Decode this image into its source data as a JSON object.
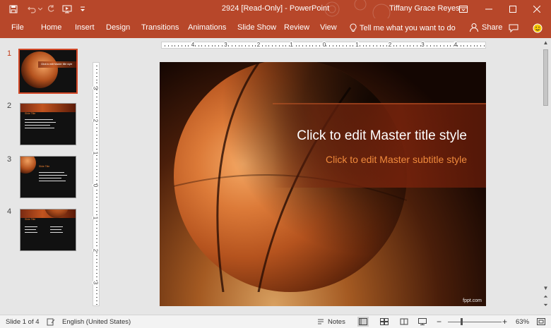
{
  "window": {
    "title": "2924 [Read-Only]  -  PowerPoint",
    "user": "Tiffany Grace Reyes"
  },
  "ribbon": {
    "tabs": [
      "File",
      "Home",
      "Insert",
      "Design",
      "Transitions",
      "Animations",
      "Slide Show",
      "Review",
      "View"
    ],
    "tell_me": "Tell me what you want to do",
    "share": "Share"
  },
  "thumbnails": [
    {
      "number": "1",
      "selected": true
    },
    {
      "number": "2",
      "selected": false
    },
    {
      "number": "3",
      "selected": false
    },
    {
      "number": "4",
      "selected": false
    }
  ],
  "ruler": {
    "horizontal_labels": [
      "4",
      "3",
      "2",
      "1",
      "0",
      "1",
      "2",
      "3",
      "4"
    ],
    "vertical_labels": [
      "3",
      "2",
      "1",
      "0",
      "1",
      "2",
      "3"
    ]
  },
  "slide": {
    "title": "Click to edit Master title style",
    "subtitle": "Click to edit Master subtitle style",
    "brand": "fppt.com"
  },
  "status": {
    "slide_info": "Slide 1 of 4",
    "language": "English (United States)",
    "notes": "Notes",
    "zoom": "63%"
  },
  "colors": {
    "accent": "#b7472a",
    "selection": "#d24726",
    "subtitle": "#f08a3c"
  }
}
